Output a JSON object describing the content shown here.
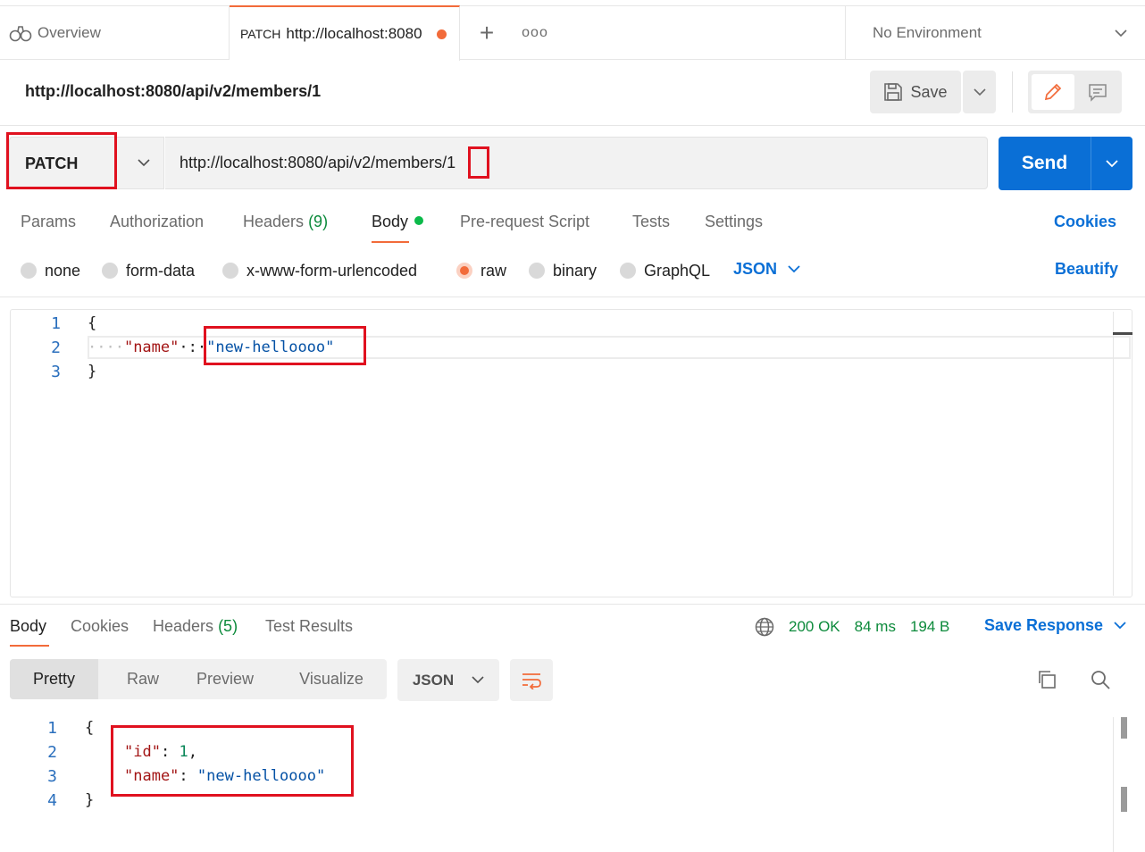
{
  "tabs": {
    "overview_label": "Overview",
    "active": {
      "method": "PATCH",
      "url": "http://localhost:8080"
    },
    "plus_label": "+",
    "more_label": "ooo"
  },
  "environment": {
    "selected": "No Environment"
  },
  "request": {
    "title": "http://localhost:8080/api/v2/members/1",
    "method": "PATCH",
    "url": "http://localhost:8080/api/v2/members/1",
    "save_label": "Save",
    "send_label": "Send"
  },
  "request_tabs": [
    {
      "label": "Params"
    },
    {
      "label": "Authorization"
    },
    {
      "label": "Headers",
      "count": "(9)"
    },
    {
      "label": "Body"
    },
    {
      "label": "Pre-request Script"
    },
    {
      "label": "Tests"
    },
    {
      "label": "Settings"
    }
  ],
  "cookies_label": "Cookies",
  "body_types": [
    {
      "label": "none",
      "checked": false
    },
    {
      "label": "form-data",
      "checked": false
    },
    {
      "label": "x-www-form-urlencoded",
      "checked": false
    },
    {
      "label": "raw",
      "checked": true
    },
    {
      "label": "binary",
      "checked": false
    },
    {
      "label": "GraphQL",
      "checked": false
    }
  ],
  "body_format": "JSON",
  "beautify_label": "Beautify",
  "request_body": {
    "line_numbers": [
      "1",
      "2",
      "3"
    ],
    "open_brace": "{",
    "indent_dots": "····",
    "key": "\"name\"",
    "sep": "·:·",
    "value": "\"new-helloooo\"",
    "close_brace": "}"
  },
  "response": {
    "tabs": [
      {
        "label": "Body"
      },
      {
        "label": "Cookies"
      },
      {
        "label": "Headers",
        "count": "(5)"
      },
      {
        "label": "Test Results"
      }
    ],
    "status": "200 OK",
    "time": "84 ms",
    "size": "194 B",
    "save_response_label": "Save Response",
    "view_modes": [
      "Pretty",
      "Raw",
      "Preview",
      "Visualize"
    ],
    "format": "JSON",
    "line_numbers": [
      "1",
      "2",
      "3",
      "4"
    ],
    "open_brace": "{",
    "id_key": "\"id\"",
    "id_value": "1",
    "name_key": "\"name\"",
    "name_value": "\"new-helloooo\"",
    "close_brace": "}"
  },
  "colors": {
    "accent_orange": "#f26b3a",
    "send_blue": "#0a6fd6",
    "status_green": "#0c8a3b",
    "annotation_red": "#e0111f"
  },
  "icons": [
    "binoculars-icon",
    "chevron-down-icon",
    "save-disk-icon",
    "pencil-icon",
    "comment-icon",
    "globe-icon",
    "wrap-lines-icon",
    "copy-icon",
    "search-icon"
  ]
}
